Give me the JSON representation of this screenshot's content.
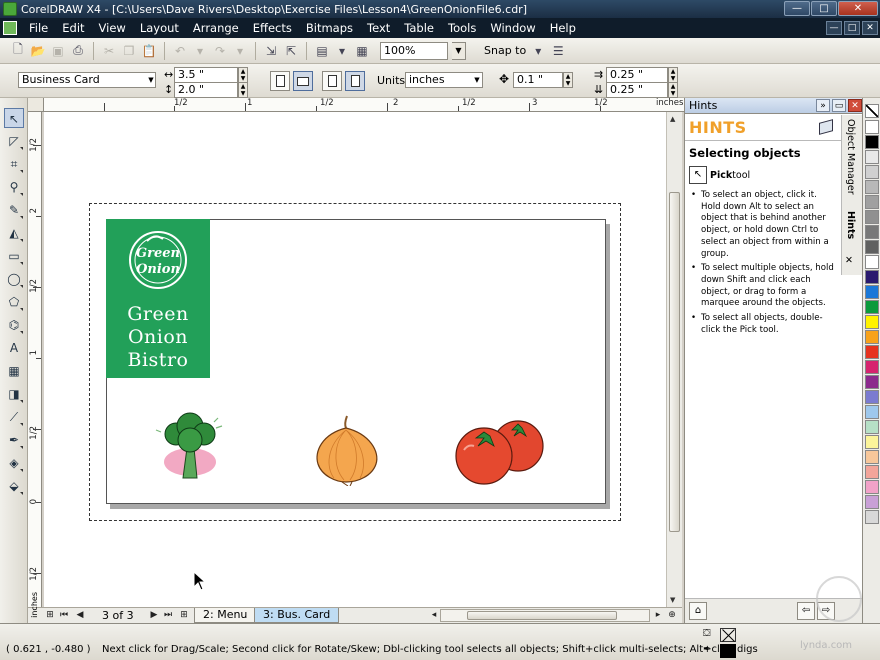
{
  "window": {
    "title": "CorelDRAW X4 - [C:\\Users\\Dave Rivers\\Desktop\\Exercise Files\\Lesson4\\GreenOnionFile6.cdr]",
    "minimize": "—",
    "maximize": "□",
    "close": "✕"
  },
  "menu": {
    "items": [
      "File",
      "Edit",
      "View",
      "Layout",
      "Arrange",
      "Effects",
      "Bitmaps",
      "Text",
      "Table",
      "Tools",
      "Window",
      "Help"
    ]
  },
  "toolbar": {
    "zoom": "100%",
    "snap_to": "Snap to"
  },
  "property_bar": {
    "paper_type": "Business Card",
    "width": "3.5 \"",
    "height": "2.0 \"",
    "units_label": "Units:",
    "units": "inches",
    "nudge": "0.1 \"",
    "dup_x": "0.25 \"",
    "dup_y": "0.25 \""
  },
  "rulers": {
    "h_labels": [
      "1/2",
      "1",
      "1/2",
      "2",
      "1/2",
      "3",
      "1/2",
      "inches"
    ],
    "v_labels": [
      "1/2",
      "2",
      "1/2",
      "1",
      "1/2",
      "0",
      "1/2"
    ],
    "unit": "inches"
  },
  "artwork": {
    "logo_ring_text": "Green Onion",
    "logo_line1": "Green",
    "logo_line2": "Onion",
    "logo_line3": "Bistro",
    "brand_green": "#22a059"
  },
  "page_nav": {
    "count": "3 of 3",
    "tabs": [
      "2: Menu",
      "3: Bus. Card"
    ],
    "active_tab": "3: Bus. Card"
  },
  "docker": {
    "header": "Hints",
    "banner": "HINTS",
    "section_title": "Selecting objects",
    "tool_name": "Pick",
    "tool_suffix": " tool",
    "bullets": [
      "To select an object, click it. Hold down Alt to select an object that is behind another object, or hold down Ctrl to select an object from within a group.",
      "To select multiple objects, hold down Shift and click each object, or drag to form a marquee around the objects.",
      "To select all objects, double-click the Pick tool."
    ],
    "vtab_object_manager": "Object Manager",
    "vtab_hints": "Hints"
  },
  "palette": {
    "colors": [
      "#ffffff",
      "#000000",
      "#e8e8e8",
      "#d0d0d0",
      "#b8b8b8",
      "#a0a0a0",
      "#909090",
      "#787878",
      "#606060",
      "#ffffff",
      "#2a1a6e",
      "#1a78d8",
      "#0b9a3c",
      "#fff200",
      "#f7a21b",
      "#e6321e",
      "#d6246e",
      "#8c2a8c",
      "#7b7bd0",
      "#9ec8ec",
      "#b6e0c6",
      "#fbf49a",
      "#f7c79a",
      "#f3a59a",
      "#f2a2c8",
      "#c9a0d6",
      "#d8d8d8"
    ]
  },
  "status": {
    "coords": "( 0.621 , -0.480 )",
    "message": "Next click for Drag/Scale; Second click for Rotate/Skew; Dbl-clicking tool selects all objects; Shift+click multi-selects; Alt+click digs"
  },
  "watermark": "lynda.com"
}
